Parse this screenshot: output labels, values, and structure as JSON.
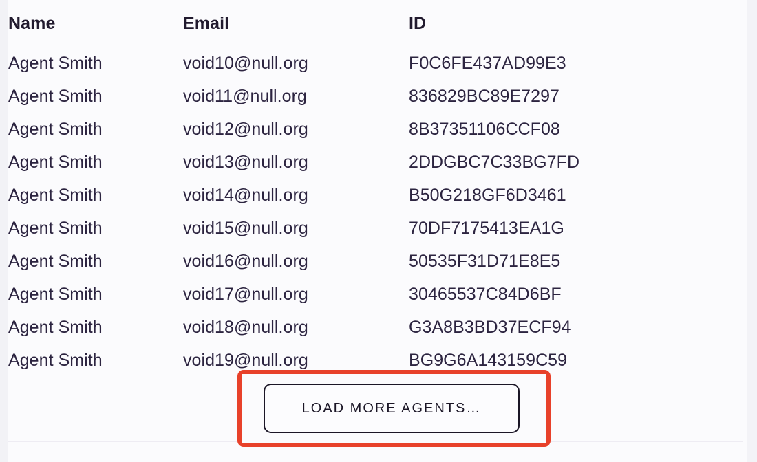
{
  "table": {
    "columns": [
      {
        "key": "name",
        "label": "Name"
      },
      {
        "key": "email",
        "label": "Email"
      },
      {
        "key": "id",
        "label": "ID"
      }
    ],
    "rows": [
      {
        "name": "Agent Smith",
        "email": "void10@null.org",
        "id": "F0C6FE437AD99E3"
      },
      {
        "name": "Agent Smith",
        "email": "void11@null.org",
        "id": "836829BC89E7297"
      },
      {
        "name": "Agent Smith",
        "email": "void12@null.org",
        "id": "8B37351106CCF08"
      },
      {
        "name": "Agent Smith",
        "email": "void13@null.org",
        "id": "2DDGBC7C33BG7FD"
      },
      {
        "name": "Agent Smith",
        "email": "void14@null.org",
        "id": "B50G218GF6D3461"
      },
      {
        "name": "Agent Smith",
        "email": "void15@null.org",
        "id": "70DF7175413EA1G"
      },
      {
        "name": "Agent Smith",
        "email": "void16@null.org",
        "id": "50535F31D71E8E5"
      },
      {
        "name": "Agent Smith",
        "email": "void17@null.org",
        "id": "30465537C84D6BF"
      },
      {
        "name": "Agent Smith",
        "email": "void18@null.org",
        "id": "G3A8B3BD37ECF94"
      },
      {
        "name": "Agent Smith",
        "email": "void19@null.org",
        "id": "BG9G6A143159C59"
      }
    ]
  },
  "footer": {
    "load_more_label": "LOAD MORE AGENTS…"
  },
  "annotation": {
    "color": "#e8412a"
  },
  "colors": {
    "background": "#fbfbfd",
    "header_text": "#211a2e",
    "body_text": "#2c2440",
    "row_divider": "#eeecf3",
    "header_divider": "#e4e2ea",
    "button_border": "#1b1626",
    "annotation_red": "#e8412a"
  }
}
